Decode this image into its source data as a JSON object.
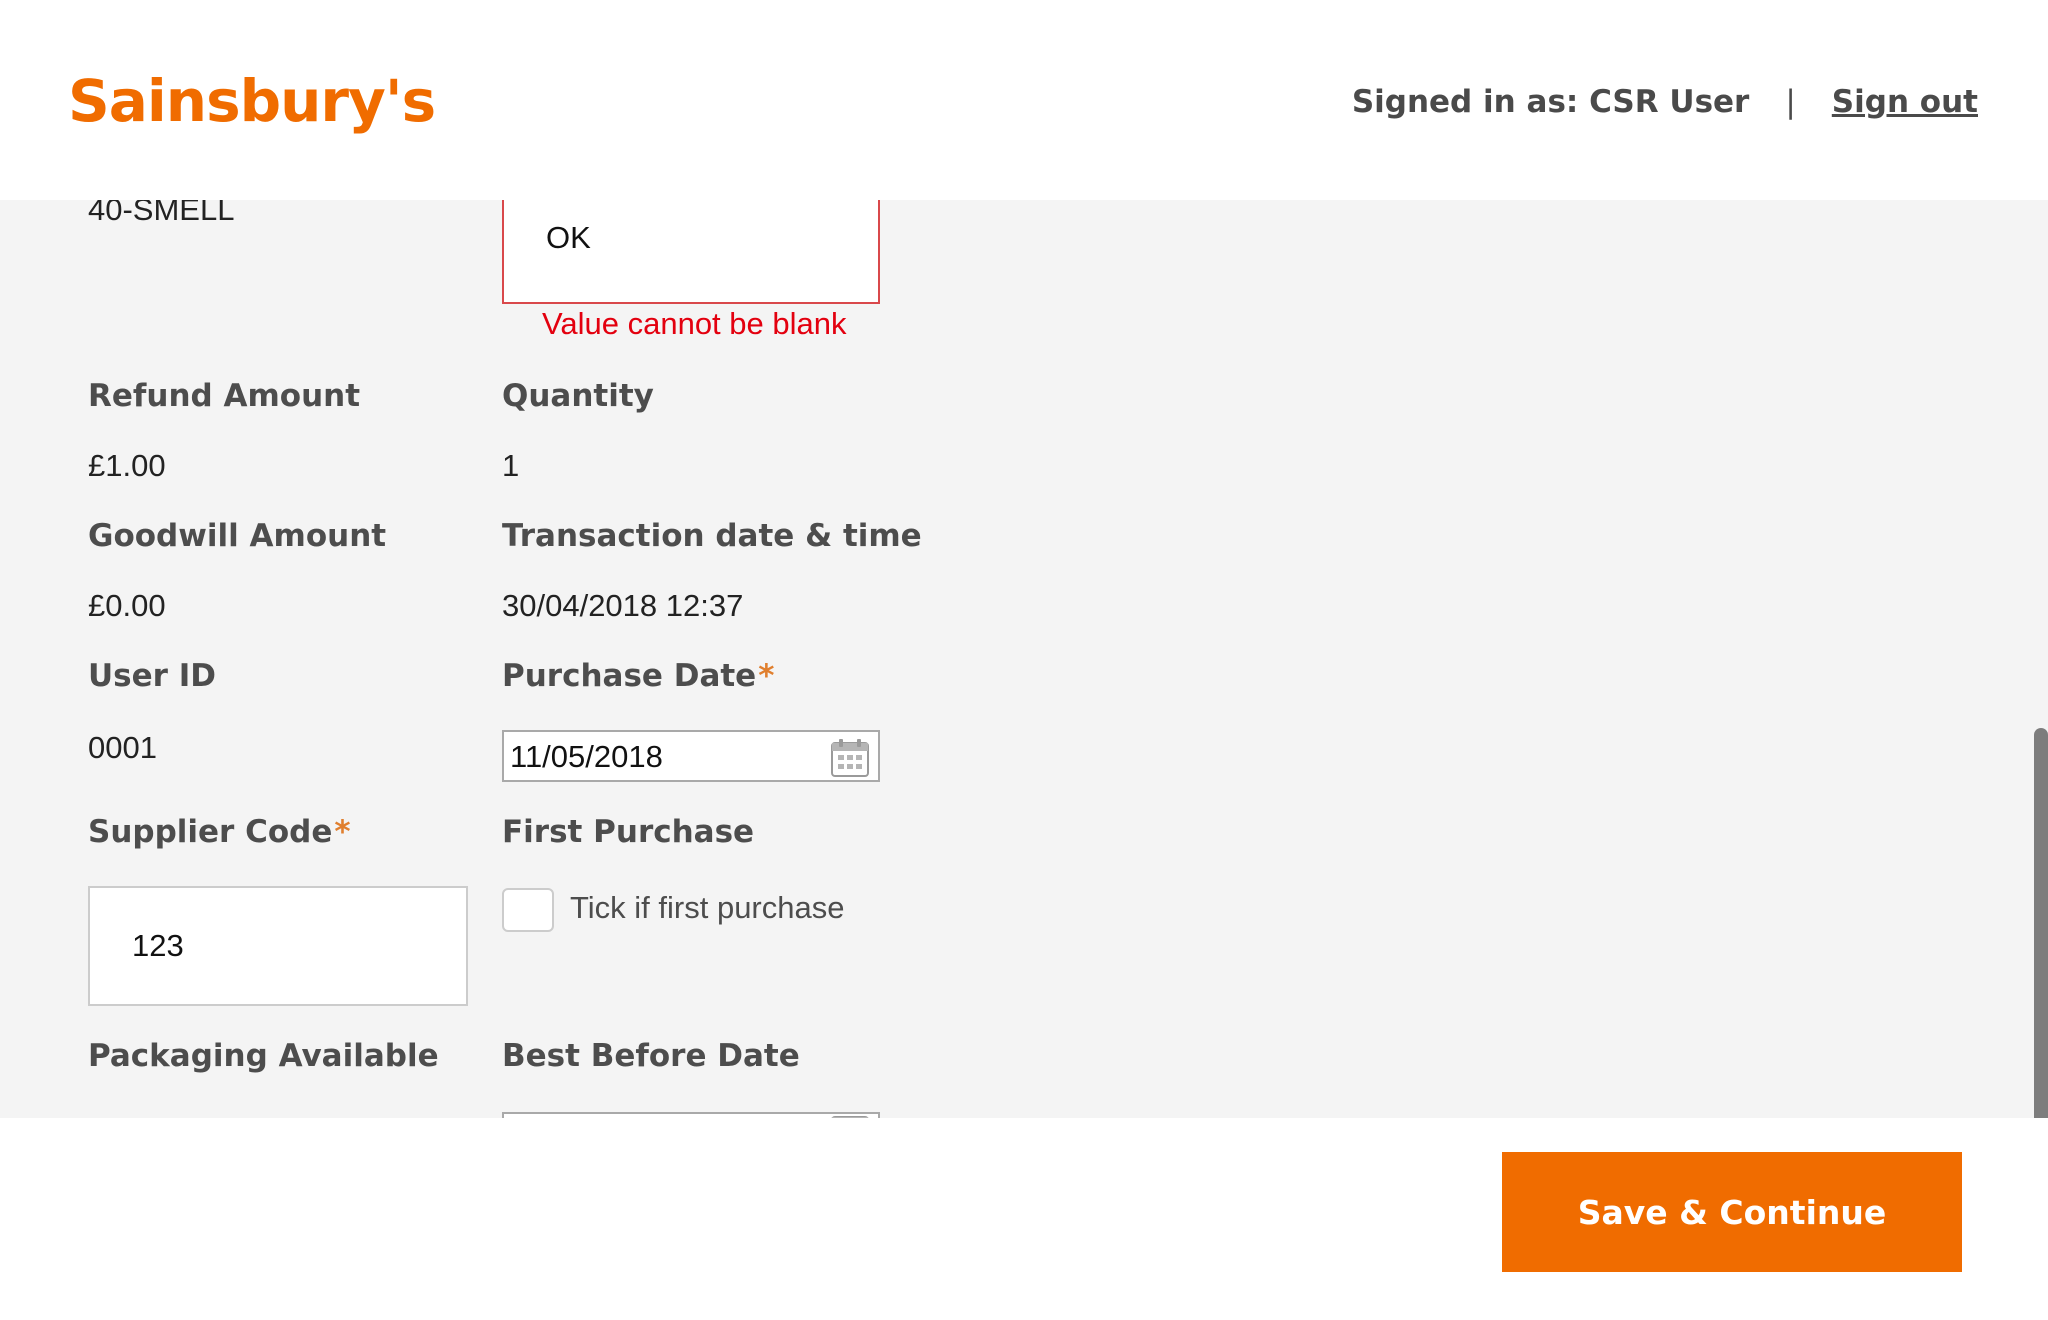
{
  "header": {
    "logo": "Sainsbury's",
    "signed_in_text": "Signed in as: CSR User",
    "separator": "|",
    "sign_out": "Sign out"
  },
  "form": {
    "reason_code": "40-SMELL",
    "comment_value": "OK",
    "comment_error": "Value cannot be blank",
    "refund_amount_label": "Refund Amount",
    "refund_amount_value": "£1.00",
    "quantity_label": "Quantity",
    "quantity_value": "1",
    "goodwill_amount_label": "Goodwill Amount",
    "goodwill_amount_value": "£0.00",
    "transaction_label": "Transaction date & time",
    "transaction_value": "30/04/2018 12:37",
    "user_id_label": "User ID",
    "user_id_value": "0001",
    "purchase_date_label": "Purchase Date",
    "purchase_date_value": "11/05/2018",
    "required_marker": "*",
    "supplier_code_label": "Supplier Code",
    "supplier_code_value": "123",
    "first_purchase_label": "First Purchase",
    "first_purchase_checkbox_label": "Tick if first purchase",
    "first_purchase_checked": false,
    "packaging_label": "Packaging Available",
    "best_before_label": "Best Before Date"
  },
  "footer": {
    "save_button": "Save & Continue"
  },
  "colors": {
    "brand_orange": "#f06c00",
    "error_red": "#e3000f",
    "required_orange": "#e07f2e"
  }
}
